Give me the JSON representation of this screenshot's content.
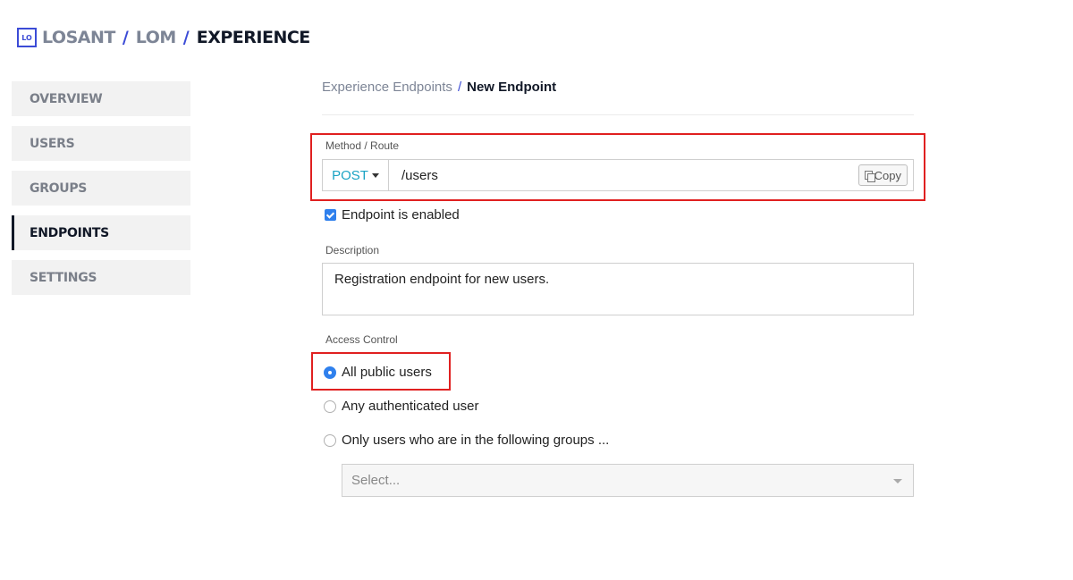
{
  "header": {
    "logo_text": "LO",
    "crumbs": [
      "LOSANT",
      "LOM",
      "EXPERIENCE"
    ],
    "separator": "/"
  },
  "sidebar": {
    "items": [
      {
        "label": "OVERVIEW",
        "active": false
      },
      {
        "label": "USERS",
        "active": false
      },
      {
        "label": "GROUPS",
        "active": false
      },
      {
        "label": "ENDPOINTS",
        "active": true
      },
      {
        "label": "SETTINGS",
        "active": false
      }
    ]
  },
  "main": {
    "breadcrumb": {
      "parent": "Experience Endpoints",
      "separator": "/",
      "current": "New Endpoint"
    },
    "route": {
      "label": "Method / Route",
      "method": "POST",
      "path": "/users",
      "copy_label": "Copy"
    },
    "enabled": {
      "label": "Endpoint is enabled",
      "checked": true
    },
    "description": {
      "label": "Description",
      "value": "Registration endpoint for new users."
    },
    "access": {
      "label": "Access Control",
      "options": [
        {
          "label": "All public users",
          "selected": true
        },
        {
          "label": "Any authenticated user",
          "selected": false
        },
        {
          "label": "Only users who are in the following groups ...",
          "selected": false
        }
      ],
      "groups_placeholder": "Select..."
    }
  },
  "colors": {
    "accent": "#3b4bd6",
    "method": "#1aa3c4",
    "checkbox": "#2f80ed",
    "highlight": "#e02020"
  }
}
